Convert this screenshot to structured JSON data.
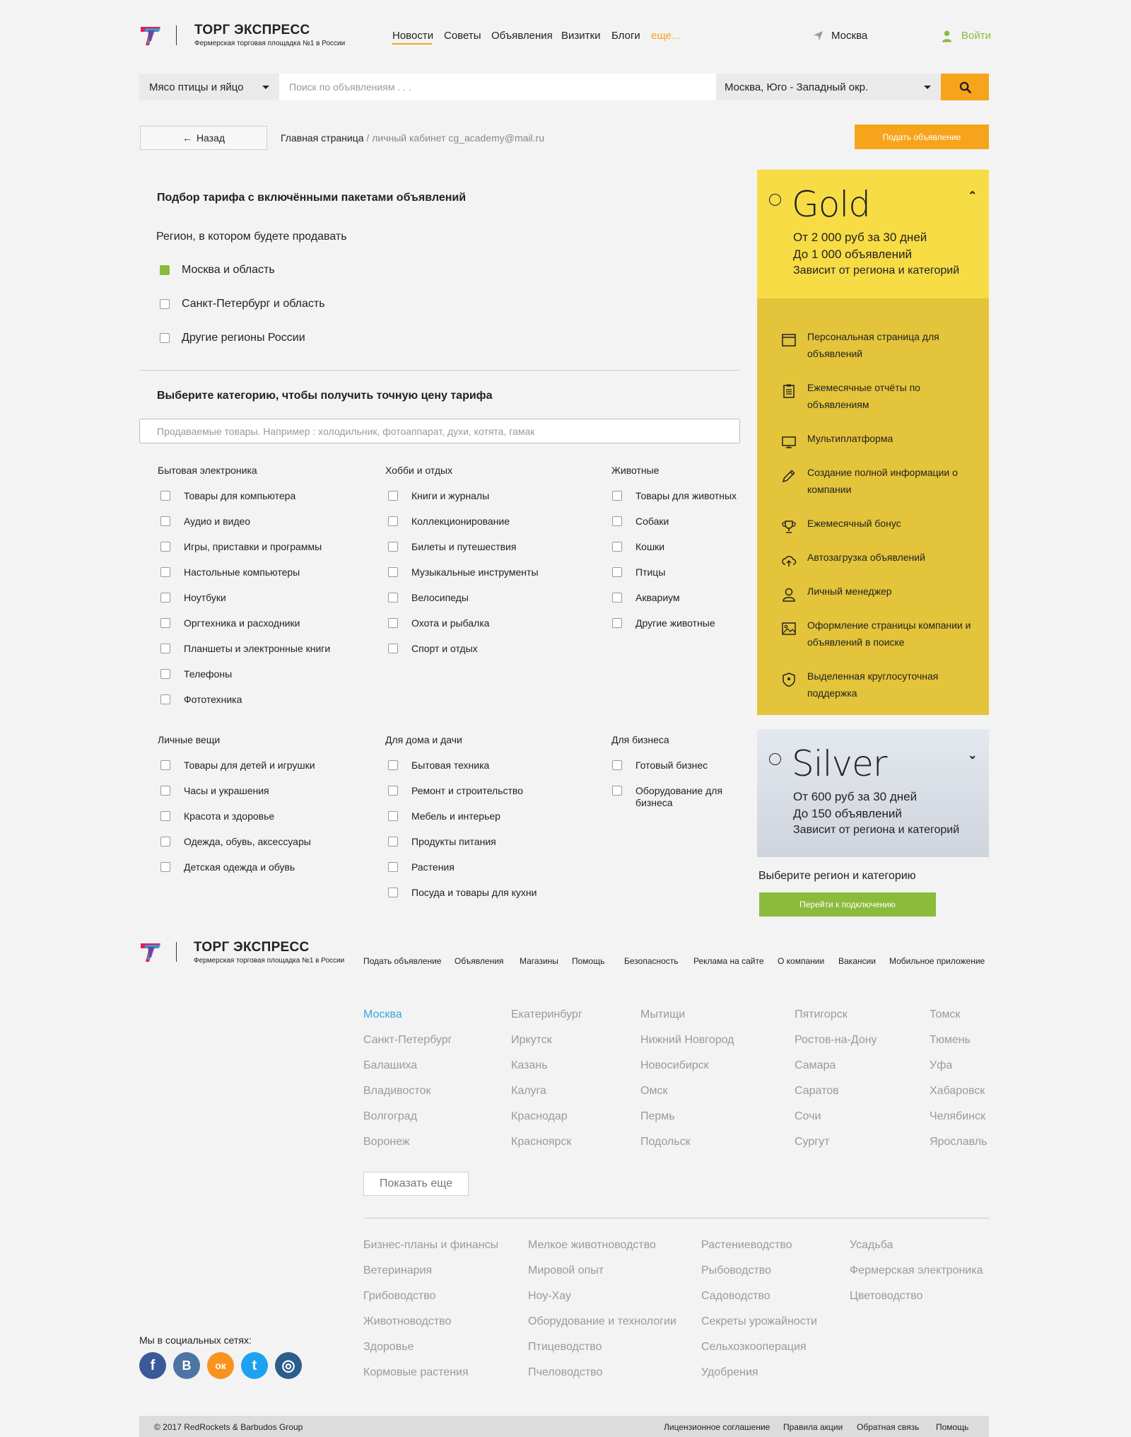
{
  "header": {
    "brand": "ТОРГ ЭКСПРЕСС",
    "tagline": "Фермерская торговая площадка №1 в России",
    "nav": [
      "Новости",
      "Советы",
      "Объявления",
      "Визитки",
      "Блоги"
    ],
    "nav_more": "еще...",
    "city": "Москва",
    "login": "Войти"
  },
  "search": {
    "category": "Мясо птицы и яйцо",
    "placeholder": "Поиск по объявлениям . . .",
    "region": "Москва, Юго - Западный окр."
  },
  "toolbar": {
    "back": "Назад",
    "breadcrumb_home": "Главная страница",
    "breadcrumb_sep": " / ",
    "breadcrumb_current": "личный кабинет cg_academy@mail.ru",
    "post_ad": "Подать объявление"
  },
  "tariff": {
    "title": "Подбор тарифа с включёнными пакетами объявлений",
    "region_question": "Регион, в котором будете продавать",
    "regions": [
      {
        "label": "Москва и область",
        "checked": true
      },
      {
        "label": "Санкт-Петербург и область",
        "checked": false
      },
      {
        "label": "Другие регионы России",
        "checked": false
      }
    ],
    "category_title": "Выберите категорию, чтобы получить точную цену тарифа",
    "category_placeholder": "Продаваемые товары. Например : холодильник, фотоаппарат, духи, котята, гамак"
  },
  "categories": [
    {
      "title": "Бытовая электроника",
      "items": [
        "Товары для компьютера",
        "Аудио и видео",
        "Игры, приставки и программы",
        "Настольные компьютеры",
        "Ноутбуки",
        "Оргтехника и расходники",
        "Планшеты и электронные книги",
        "Телефоны",
        "Фототехника"
      ]
    },
    {
      "title": "Хобби и отдых",
      "items": [
        "Книги и журналы",
        "Коллекционирование",
        "Билеты и путешествия",
        "Музыкальные инструменты",
        "Велосипеды",
        "Охота и рыбалка",
        "Спорт и отдых"
      ]
    },
    {
      "title": "Животные",
      "items": [
        "Товары для животных",
        "Собаки",
        "Кошки",
        "Птицы",
        "Аквариум",
        "Другие животные"
      ]
    },
    {
      "title": "Личные вещи",
      "items": [
        "Товары для детей и игрушки",
        "Часы и украшения",
        "Красота и здоровье",
        "Одежда, обувь, аксессуары",
        "Детская одежда и обувь"
      ]
    },
    {
      "title": "Для дома и дачи",
      "items": [
        "Бытовая техника",
        "Ремонт и строительство",
        "Мебель и интерьер",
        "Продукты питания",
        "Растения",
        "Посуда и товары для кухни"
      ]
    },
    {
      "title": "Для бизнеса",
      "items": [
        "Готовый бизнес",
        "Оборудование для бизнеса"
      ]
    }
  ],
  "gold": {
    "name": "Gold",
    "price": "От 2 000 руб за 30 дней",
    "ads": "До 1 000 объявлений",
    "note": "Зависит от региона и категорий",
    "color": "#f7dc45",
    "features": [
      {
        "icon": "browser-window-icon",
        "text": "Персональная страница для объявлений"
      },
      {
        "icon": "clipboard-report-icon",
        "text": "Ежемесячные отчёты по объявлениям"
      },
      {
        "icon": "monitor-icon",
        "text": "Мультиплатформа"
      },
      {
        "icon": "pencil-icon",
        "text": "Создание полной информации о компании"
      },
      {
        "icon": "trophy-icon",
        "text": "Ежемесячный бонус"
      },
      {
        "icon": "cloud-upload-icon",
        "text": "Автозагрузка объявлений"
      },
      {
        "icon": "person-icon",
        "text": "Личный менеджер"
      },
      {
        "icon": "image-icon",
        "text": "Оформление страницы компании и объявлений в поиске"
      },
      {
        "icon": "shield-icon",
        "text": "Выделенная круглосуточная поддержка"
      }
    ]
  },
  "silver": {
    "name": "Silver",
    "price": "От 600 руб за 30 дней",
    "ads": "До 150 объявлений",
    "note": "Зависит от региона и категорий"
  },
  "connect": {
    "prompt": "Выберите регион и категорию",
    "button": "Перейти к подключению"
  },
  "footer": {
    "brand": "ТОРГ ЭКСПРЕСС",
    "tagline": "Фермерская торговая площадка №1 в России",
    "nav": [
      "Подать объявление",
      "Объявления",
      "Магазины",
      "Помощь",
      "Безопасность",
      "Реклама на сайте",
      "О компании",
      "Вакансии",
      "Мобильное приложение"
    ],
    "city_columns": [
      [
        "Москва",
        "Санкт-Петербург",
        "Балашиха",
        "Владивосток",
        "Волгоград",
        "Воронеж"
      ],
      [
        "Екатеринбург",
        "Иркутск",
        "Казань",
        "Калуга",
        "Краснодар",
        "Красноярск"
      ],
      [
        "Мытищи",
        "Нижний Новгород",
        "Новосибирск",
        "Омск",
        "Пермь",
        "Подольск"
      ],
      [
        "Пятигорск",
        "Ростов-на-Дону",
        "Самара",
        "Саратов",
        "Сочи",
        "Сургут"
      ],
      [
        "Томск",
        "Тюмень",
        "Уфа",
        "Хабаровск",
        "Челябинск",
        "Ярославль"
      ]
    ],
    "show_more": "Показать еще",
    "topic_columns": [
      [
        "Бизнес-планы и финансы",
        "Ветеринария",
        "Грибоводство",
        "Животноводство",
        "Здоровье",
        "Кормовые растения"
      ],
      [
        "Мелкое животноводство",
        "Мировой опыт",
        "Ноу-Хау",
        "Оборудование и технологии",
        "Птицеводство",
        "Пчеловодство"
      ],
      [
        "Растениеводство",
        "Рыбоводство",
        "Садоводство",
        "Секреты урожайности",
        "Сельхозкооперация",
        "Удобрения"
      ],
      [
        "Усадьба",
        "Фермерская электроника",
        "Цветоводство"
      ]
    ],
    "social_title": "Мы в социальных сетях:",
    "social": [
      {
        "icon": "facebook-icon",
        "glyph": "f",
        "color": "#3b5998"
      },
      {
        "icon": "vk-icon",
        "glyph": "В",
        "color": "#4c75a3"
      },
      {
        "icon": "odnoklassniki-icon",
        "glyph": "ок",
        "color": "#f7931e"
      },
      {
        "icon": "twitter-icon",
        "glyph": "t",
        "color": "#1da1f2"
      },
      {
        "icon": "instagram-icon",
        "glyph": "◎",
        "color": "#2a5d8c"
      }
    ],
    "copyright": "© 2017 RedRockets & Barbudos Group",
    "bottom_links": [
      "Лицензионное соглашение",
      "Правила акции",
      "Обратная связь",
      "Помощь"
    ]
  }
}
